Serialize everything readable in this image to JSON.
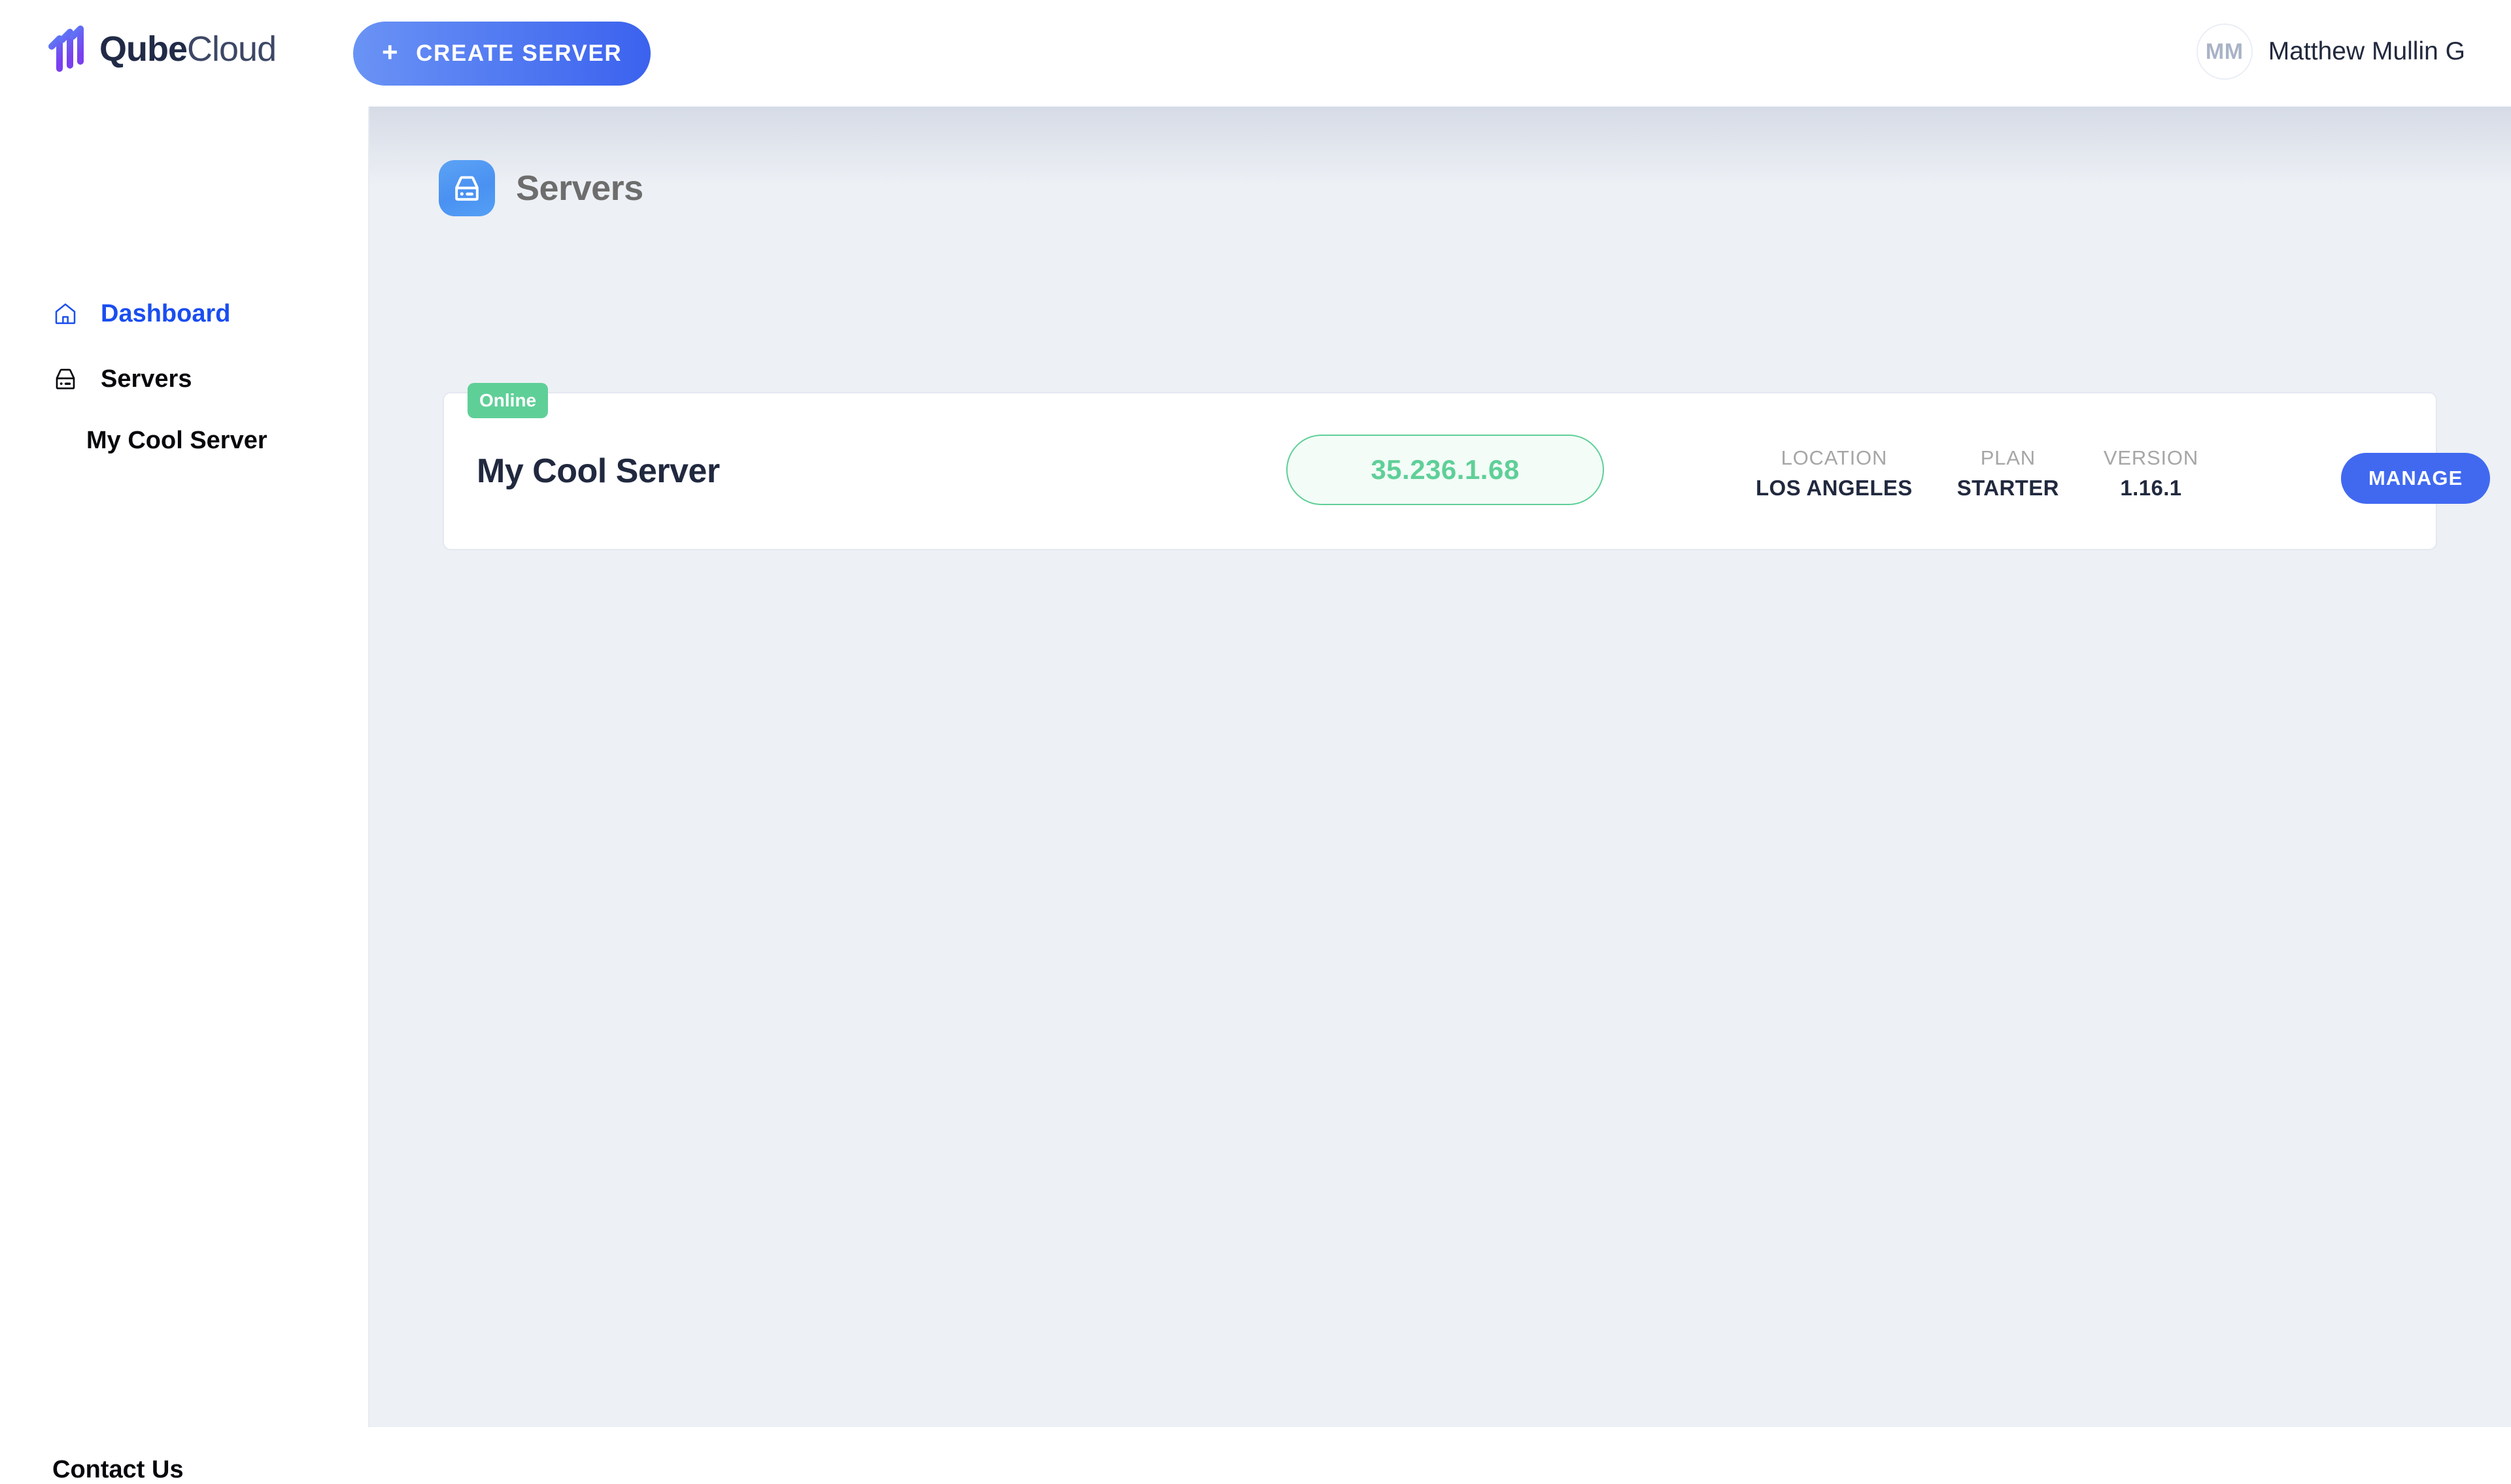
{
  "brand": {
    "name_bold": "Qube",
    "name_light": "Cloud",
    "logo_icon": "qubecloud-bars-icon",
    "accent_blue": "#4169f0",
    "accent_purple": "#6c4df0",
    "accent_green": "#5fcf98"
  },
  "topbar": {
    "create_button": {
      "label": "CREATE SERVER",
      "plus": "+"
    },
    "user": {
      "initials": "MM",
      "name": "Matthew Mullin G"
    }
  },
  "sidebar": {
    "items": [
      {
        "label": "Dashboard",
        "icon": "home-icon",
        "active": true
      },
      {
        "label": "Servers",
        "icon": "server-icon",
        "active": false
      }
    ],
    "subitems": [
      {
        "label": "My Cool Server"
      }
    ],
    "footer": {
      "label": "Contact Us"
    }
  },
  "page": {
    "title": "Servers",
    "icon": "server-icon"
  },
  "servers": [
    {
      "status": "Online",
      "name": "My Cool Server",
      "ip": "35.236.1.68",
      "meta": [
        {
          "label": "LOCATION",
          "value": "LOS ANGELES"
        },
        {
          "label": "PLAN",
          "value": "STARTER"
        },
        {
          "label": "VERSION",
          "value": "1.16.1"
        }
      ],
      "manage_label": "MANAGE",
      "actions": [
        {
          "icon": "list-icon"
        },
        {
          "icon": "pie-chart-icon"
        },
        {
          "icon": "more-horizontal-icon"
        }
      ]
    }
  ]
}
